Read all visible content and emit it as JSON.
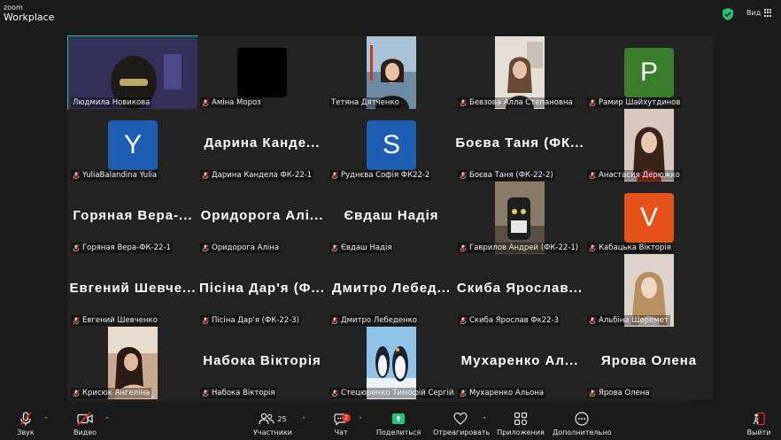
{
  "app": {
    "brand_small": "zoom",
    "brand_big": "Workplace",
    "view_label": "Вид"
  },
  "colors": {
    "accent_green": "#21c47a",
    "muted_red": "#e02828",
    "share_green": "#21c47a"
  },
  "participants": [
    {
      "name": "Людмила Новикова",
      "type": "video",
      "active": true,
      "muted": false
    },
    {
      "name": "Аміна Мороз",
      "type": "black",
      "muted": true
    },
    {
      "name": "Тетяна Дятченко",
      "type": "video",
      "muted": false
    },
    {
      "name": "Бевзова Алла Степановна",
      "type": "video",
      "muted": true
    },
    {
      "name": "Рамир Шайхутдинов",
      "type": "letter",
      "letter": "P",
      "color": "#3a7d2a",
      "muted": true
    },
    {
      "name": "YuliaBalandina Yulia",
      "type": "letter",
      "letter": "Y",
      "color": "#1f5fb3",
      "muted": true
    },
    {
      "name": "Дарина Кандела ФК-22-1",
      "type": "text",
      "display": "Дарина Канде...",
      "muted": true
    },
    {
      "name": "Руднєва Софія ФК22-2",
      "type": "letter",
      "letter": "S",
      "color": "#1f5fb3",
      "muted": true
    },
    {
      "name": "Боєва Таня (ФК-22-2)",
      "type": "text",
      "display": "Боєва Таня (ФК...",
      "muted": true
    },
    {
      "name": "Анастасия Дерюжко",
      "type": "video",
      "muted": true
    },
    {
      "name": "Горяная Вера-ФК-22-1",
      "type": "text",
      "display": "Горяная Вера-...",
      "muted": true
    },
    {
      "name": "Оридорога Аліна",
      "type": "text",
      "display": "Оридорога Алі...",
      "muted": true
    },
    {
      "name": "Євдаш Надія",
      "type": "text",
      "display": "Євдаш Надія",
      "muted": true
    },
    {
      "name": "Гаврилов Андрей (ФК-22-1)",
      "type": "video",
      "muted": true
    },
    {
      "name": "Кабацька Вікторія",
      "type": "letter",
      "letter": "V",
      "color": "#e5531a",
      "muted": true
    },
    {
      "name": "Евгений Шевченко",
      "type": "text",
      "display": "Евгений Шевче...",
      "muted": true
    },
    {
      "name": "Пісіна Дар'я (ФК-22-3)",
      "type": "text",
      "display": "Пісіна Дар'я (Ф...",
      "muted": true
    },
    {
      "name": "Дмитро Лебеденко",
      "type": "text",
      "display": "Дмитро Лебед...",
      "muted": true
    },
    {
      "name": "Скиба Ярослав Фк22-3",
      "type": "text",
      "display": "Скиба Ярослав...",
      "muted": true
    },
    {
      "name": "Альбіна Шеремет",
      "type": "video",
      "muted": true
    },
    {
      "name": "Крисюк Ангеліна",
      "type": "video",
      "muted": true
    },
    {
      "name": "Набока Вікторія",
      "type": "text",
      "display": "Набока Вікторія",
      "muted": true
    },
    {
      "name": "Стецюренко Тимофій Сергійо...",
      "type": "video",
      "muted": true
    },
    {
      "name": "Мухаренко Альона",
      "type": "text",
      "display": "Мухаренко Ал...",
      "muted": true
    },
    {
      "name": "Ярова Олена",
      "type": "text",
      "display": "Ярова Олена",
      "muted": true
    }
  ],
  "toolbar": {
    "audio_label": "Звук",
    "video_label": "Видео",
    "participants_label": "Участники",
    "participants_count": "25",
    "chat_label": "Чат",
    "chat_badge": "2",
    "share_label": "Поделиться",
    "react_label": "Отреагировать",
    "apps_label": "Приложения",
    "more_label": "Дополнительно",
    "leave_label": "Выйти"
  }
}
